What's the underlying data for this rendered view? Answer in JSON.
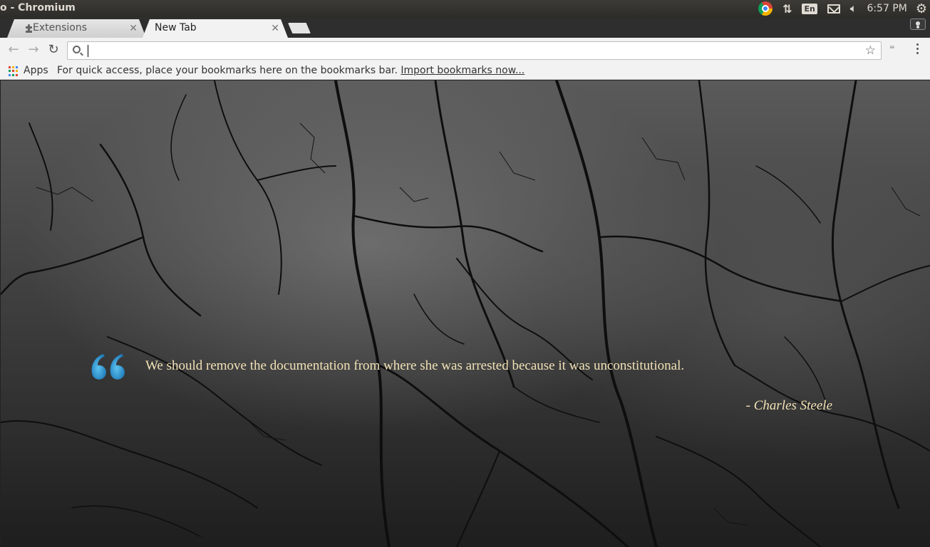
{
  "window": {
    "title": "o - Chromium"
  },
  "tray": {
    "lang": "En",
    "time": "6:57 PM"
  },
  "tabs": [
    {
      "label": "Extensions",
      "icon": "puzzle-icon",
      "active": false
    },
    {
      "label": "New Tab",
      "icon": "",
      "active": true
    }
  ],
  "omnibox": {
    "value": "",
    "placeholder": ""
  },
  "bookmarks": {
    "apps_label": "Apps",
    "hint": "For quick access, place your bookmarks here on the bookmarks bar.",
    "import_link": "Import bookmarks now..."
  },
  "quote": {
    "text": "We should remove the documentation from where she was arrested because it was unconstitutional.",
    "author": "- Charles Steele"
  },
  "colors": {
    "quote_text": "#f1e1b6",
    "quote_mark": "#2a8fd0",
    "panel": "#3c3b37"
  }
}
